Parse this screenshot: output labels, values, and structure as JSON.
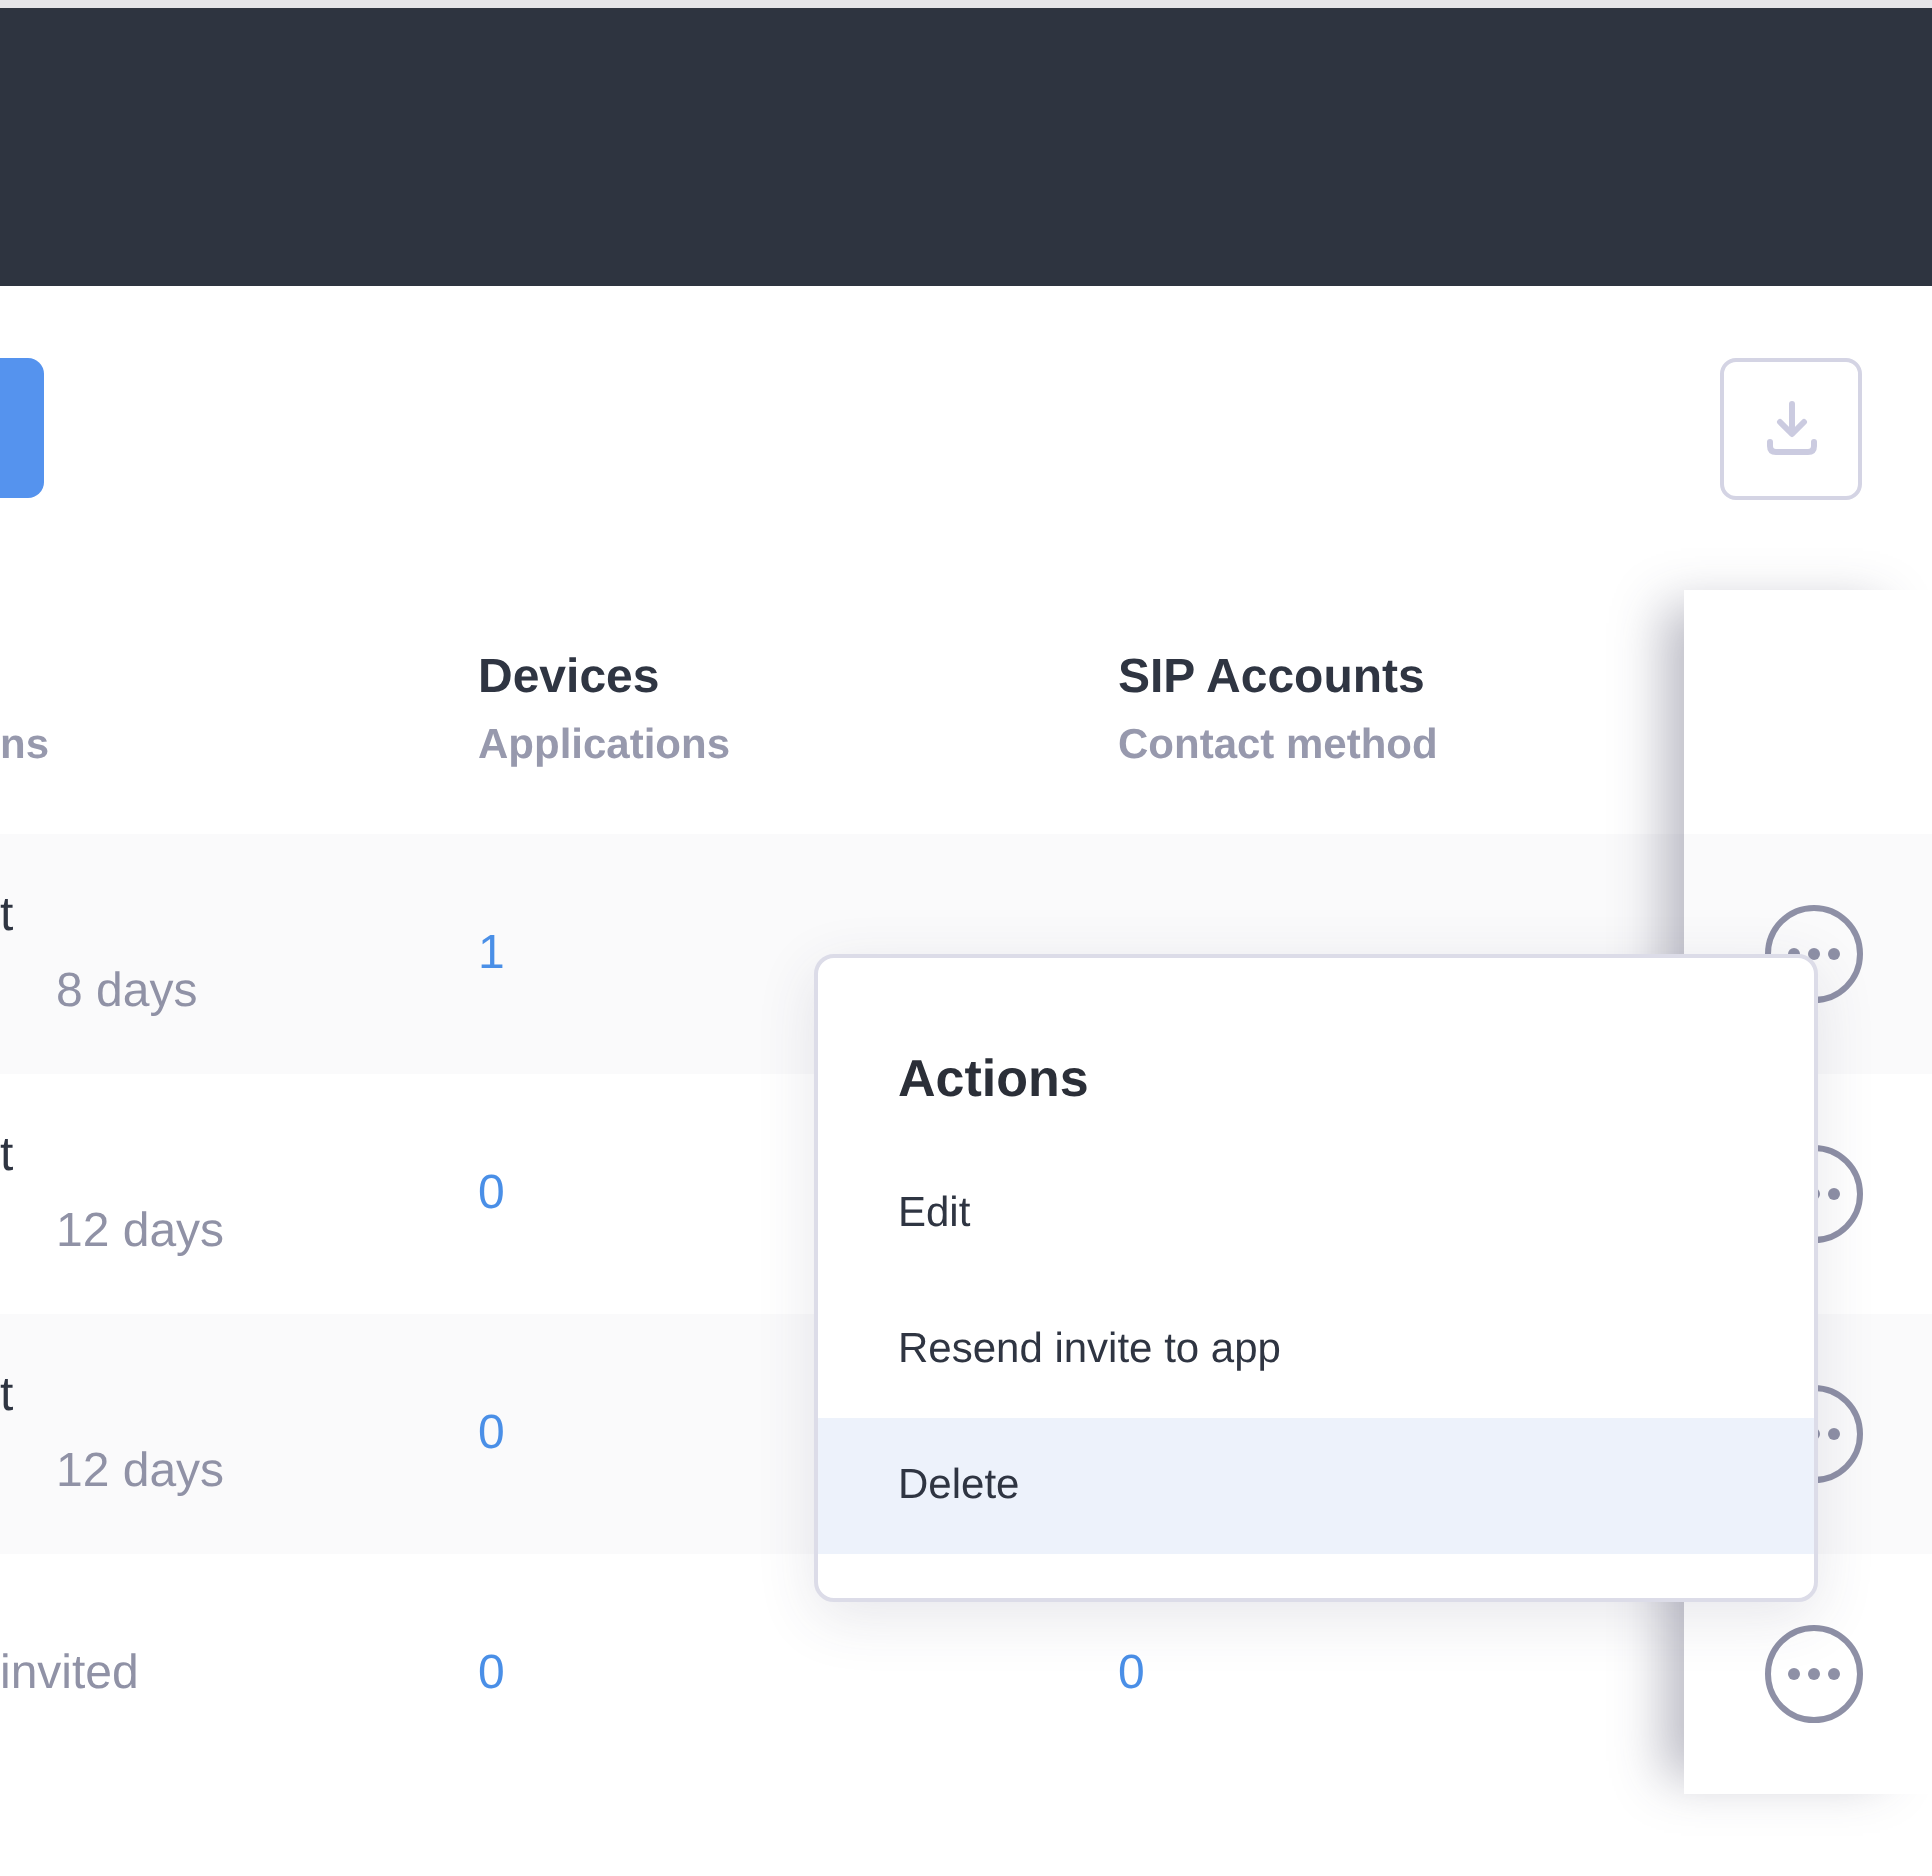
{
  "toolbar": {
    "export_button": {
      "disabled": false
    }
  },
  "table": {
    "columns": [
      {
        "subtitle": "ns"
      },
      {
        "title": "Devices",
        "subtitle": "Applications"
      },
      {
        "title": "SIP Accounts",
        "subtitle": "Contact method"
      }
    ],
    "rows": [
      {
        "column_1": "t",
        "column_1_detail": "8 days",
        "devices": "1"
      },
      {
        "column_1": "t",
        "column_1_detail": "12 days",
        "devices": "0"
      },
      {
        "column_1": "t",
        "column_1_detail": "12 days",
        "devices": "0"
      },
      {
        "column_1_detail": "invited",
        "devices": "0",
        "sip_accounts": "0"
      }
    ]
  },
  "menu": {
    "title": "Actions",
    "items": [
      {
        "label": "Edit",
        "selected": false
      },
      {
        "label": "Resend invite to app",
        "selected": false
      },
      {
        "label": "Delete",
        "selected": true
      }
    ]
  }
}
